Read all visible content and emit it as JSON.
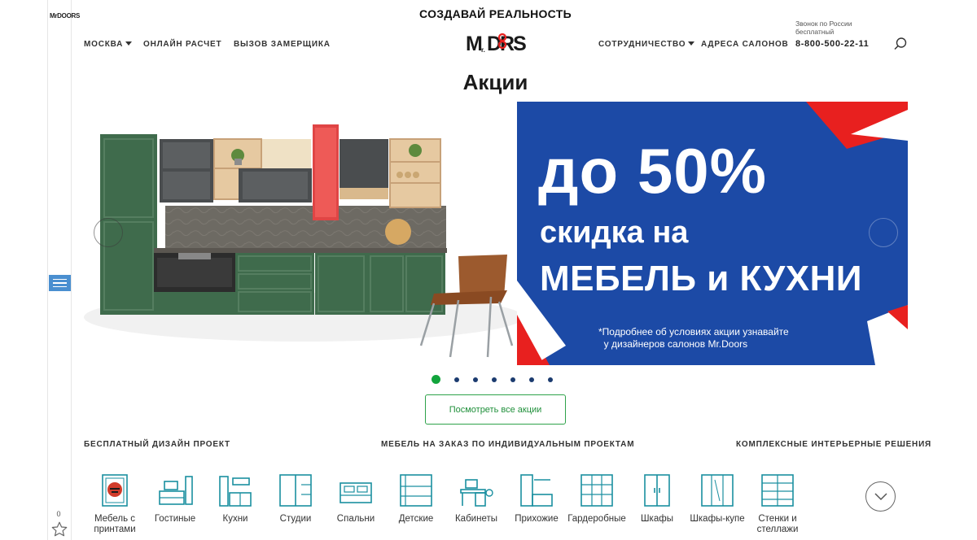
{
  "header": {
    "slogan": "СОЗДАВАЙ РЕАЛЬНОСТЬ",
    "logo_text": "Mr.DOORS",
    "nav_left": [
      {
        "label": "МОСКВА",
        "dropdown": true
      },
      {
        "label": "ОНЛАЙН РАСЧЕТ",
        "dropdown": false
      },
      {
        "label": "ВЫЗОВ ЗАМЕРЩИКА",
        "dropdown": false
      }
    ],
    "nav_right": [
      {
        "label": "СОТРУДНИЧЕСТВО",
        "dropdown": true
      },
      {
        "label": "АДРЕСА САЛОНОВ",
        "dropdown": false
      }
    ],
    "phone_caption_1": "Звонок по России",
    "phone_caption_2": "бесплатный",
    "phone": "8-800-500-22-11",
    "search_icon": "search-icon"
  },
  "rail": {
    "logo_text": "MrDOORS",
    "menu_icon": "hamburger-menu-icon",
    "favorites_count": "0",
    "favorites_icon": "star-icon"
  },
  "page": {
    "title": "Акции"
  },
  "banner": {
    "headline": "до 50%",
    "subline_1": "скидка на",
    "subline_2": "МЕБЕЛЬ и КУХНИ",
    "note_1": "*Подробнее об условиях акции узнавайте",
    "note_2": "у дизайнеров салонов Mr.Doors",
    "colors": {
      "promo_bg": "#1c4aa6",
      "accent_red": "#e8201f",
      "kitchen_green": "#3f6b4c"
    },
    "slides_total": 7,
    "active_slide": 1
  },
  "all_promos_button": "Посмотреть все акции",
  "sections": {
    "left": "БЕСПЛАТНЫЙ ДИЗАЙН ПРОЕКТ",
    "center": "МЕБЕЛЬ НА ЗАКАЗ ПО ИНДИВИДУАЛЬНЫМ ПРОЕКТАМ",
    "right": "КОМПЛЕКСНЫЕ ИНТЕРЬЕРНЫЕ РЕШЕНИЯ"
  },
  "categories": [
    {
      "label": "Мебель с принтами",
      "icon": "printed-furniture-icon"
    },
    {
      "label": "Гостиные",
      "icon": "living-room-icon"
    },
    {
      "label": "Кухни",
      "icon": "kitchen-icon"
    },
    {
      "label": "Студии",
      "icon": "studio-icon"
    },
    {
      "label": "Спальни",
      "icon": "bedroom-icon"
    },
    {
      "label": "Детские",
      "icon": "kids-room-icon"
    },
    {
      "label": "Кабинеты",
      "icon": "office-icon"
    },
    {
      "label": "Прихожие",
      "icon": "hallway-icon"
    },
    {
      "label": "Гардеробные",
      "icon": "walk-in-closet-icon"
    },
    {
      "label": "Шкафы",
      "icon": "wardrobe-icon"
    },
    {
      "label": "Шкафы-купе",
      "icon": "sliding-wardrobe-icon"
    },
    {
      "label": "Стенки и стеллажи",
      "icon": "shelving-icon"
    }
  ],
  "categories_next_icon": "chevron-down-icon"
}
